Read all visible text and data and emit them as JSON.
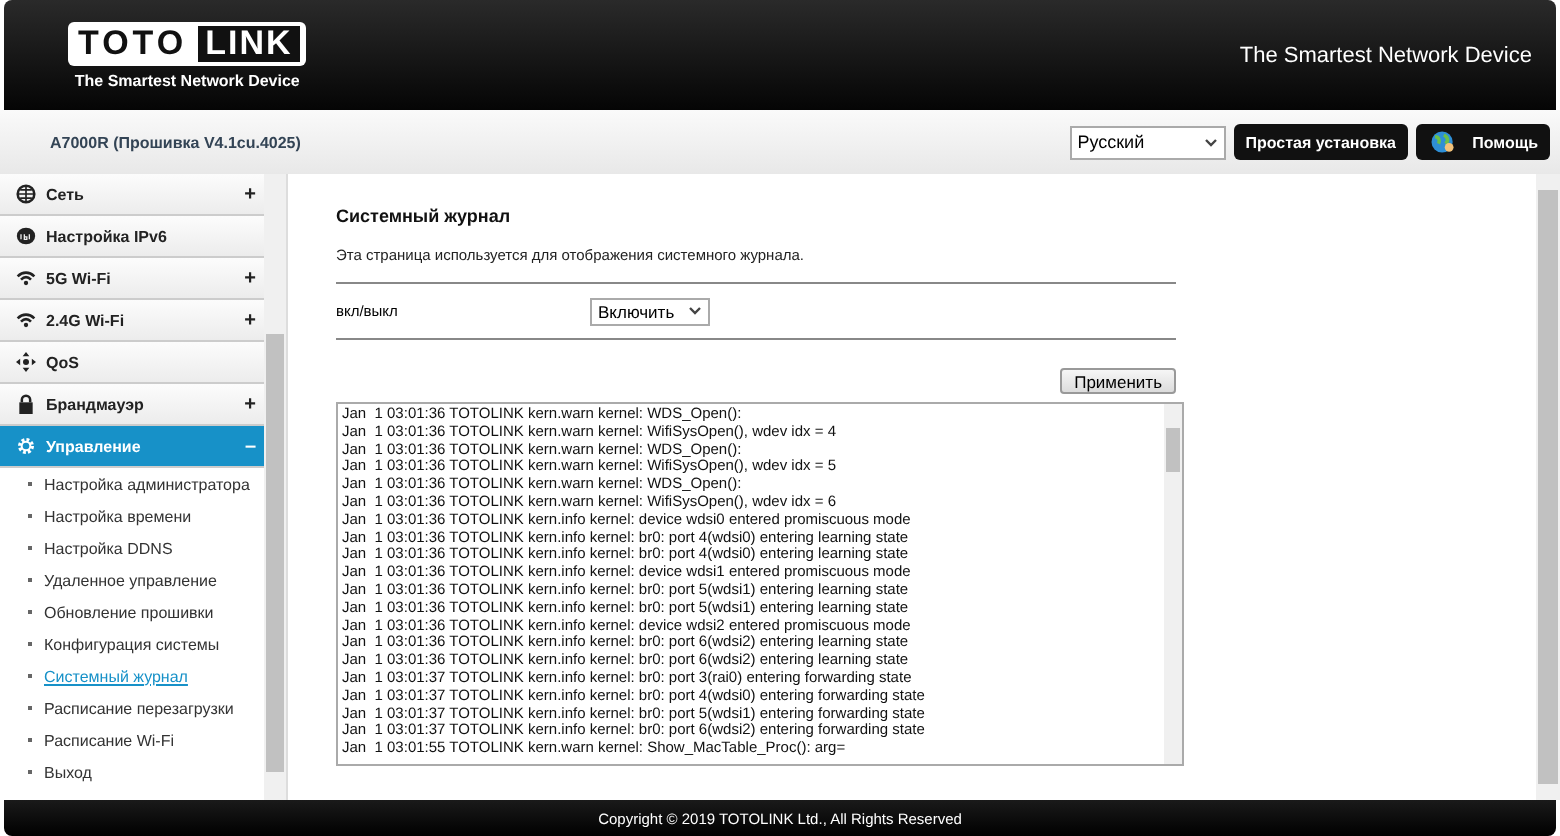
{
  "header": {
    "logo_left": "TOTO",
    "logo_right": "LINK",
    "logo_tagline": "The Smartest Network Device",
    "slogan": "The Smartest Network Device"
  },
  "toolbar": {
    "model": "A7000R (Прошивка V4.1cu.4025)",
    "language": "Русский",
    "quick_setup": "Простая установка",
    "help": "Помощь"
  },
  "sidebar": {
    "items": [
      {
        "kind": "globe",
        "label": "Сеть",
        "sign": "+",
        "selected": false
      },
      {
        "kind": "ipv6",
        "label": "Настройка IPv6",
        "selected": false
      },
      {
        "kind": "wifi",
        "label": "5G Wi-Fi",
        "sign": "+",
        "selected": false
      },
      {
        "kind": "wifi",
        "label": "2.4G Wi-Fi",
        "sign": "+",
        "selected": false
      },
      {
        "kind": "qos",
        "label": "QoS",
        "selected": false
      },
      {
        "kind": "lock",
        "label": "Брандмауэр",
        "sign": "+",
        "selected": false
      },
      {
        "kind": "gear",
        "label": "Управление",
        "sign": "–",
        "selected": true,
        "children": [
          {
            "label": "Настройка администратора",
            "selected": false
          },
          {
            "label": "Настройка времени",
            "selected": false
          },
          {
            "label": "Настройка DDNS",
            "selected": false
          },
          {
            "label": "Удаленное управление",
            "selected": false
          },
          {
            "label": "Обновление прошивки",
            "selected": false
          },
          {
            "label": "Конфигурация системы",
            "selected": false
          },
          {
            "label": "Системный журнал",
            "selected": true
          },
          {
            "label": "Расписание перезагрузки",
            "selected": false
          },
          {
            "label": "Расписание Wi-Fi",
            "selected": false
          },
          {
            "label": "Выход",
            "selected": false
          }
        ]
      }
    ]
  },
  "page": {
    "title": "Системный журнал",
    "description": "Эта страница используется для отображения системного журнала.",
    "toggle_label": "вкл/выкл",
    "toggle_value": "Включить",
    "apply": "Применить",
    "log_lines": [
      "Jan  1 03:01:36 TOTOLINK kern.warn kernel: WDS_Open():",
      "Jan  1 03:01:36 TOTOLINK kern.warn kernel: WifiSysOpen(), wdev idx = 4",
      "Jan  1 03:01:36 TOTOLINK kern.warn kernel: WDS_Open():",
      "Jan  1 03:01:36 TOTOLINK kern.warn kernel: WifiSysOpen(), wdev idx = 5",
      "Jan  1 03:01:36 TOTOLINK kern.warn kernel: WDS_Open():",
      "Jan  1 03:01:36 TOTOLINK kern.warn kernel: WifiSysOpen(), wdev idx = 6",
      "Jan  1 03:01:36 TOTOLINK kern.info kernel: device wdsi0 entered promiscuous mode",
      "Jan  1 03:01:36 TOTOLINK kern.info kernel: br0: port 4(wdsi0) entering learning state",
      "Jan  1 03:01:36 TOTOLINK kern.info kernel: br0: port 4(wdsi0) entering learning state",
      "Jan  1 03:01:36 TOTOLINK kern.info kernel: device wdsi1 entered promiscuous mode",
      "Jan  1 03:01:36 TOTOLINK kern.info kernel: br0: port 5(wdsi1) entering learning state",
      "Jan  1 03:01:36 TOTOLINK kern.info kernel: br0: port 5(wdsi1) entering learning state",
      "Jan  1 03:01:36 TOTOLINK kern.info kernel: device wdsi2 entered promiscuous mode",
      "Jan  1 03:01:36 TOTOLINK kern.info kernel: br0: port 6(wdsi2) entering learning state",
      "Jan  1 03:01:36 TOTOLINK kern.info kernel: br0: port 6(wdsi2) entering learning state",
      "Jan  1 03:01:37 TOTOLINK kern.info kernel: br0: port 3(rai0) entering forwarding state",
      "Jan  1 03:01:37 TOTOLINK kern.info kernel: br0: port 4(wdsi0) entering forwarding state",
      "Jan  1 03:01:37 TOTOLINK kern.info kernel: br0: port 5(wdsi1) entering forwarding state",
      "Jan  1 03:01:37 TOTOLINK kern.info kernel: br0: port 6(wdsi2) entering forwarding state",
      "Jan  1 03:01:55 TOTOLINK kern.warn kernel: Show_MacTable_Proc(): arg="
    ]
  },
  "footer": {
    "copyright": "Copyright © 2019 TOTOLINK Ltd., All Rights Reserved"
  }
}
